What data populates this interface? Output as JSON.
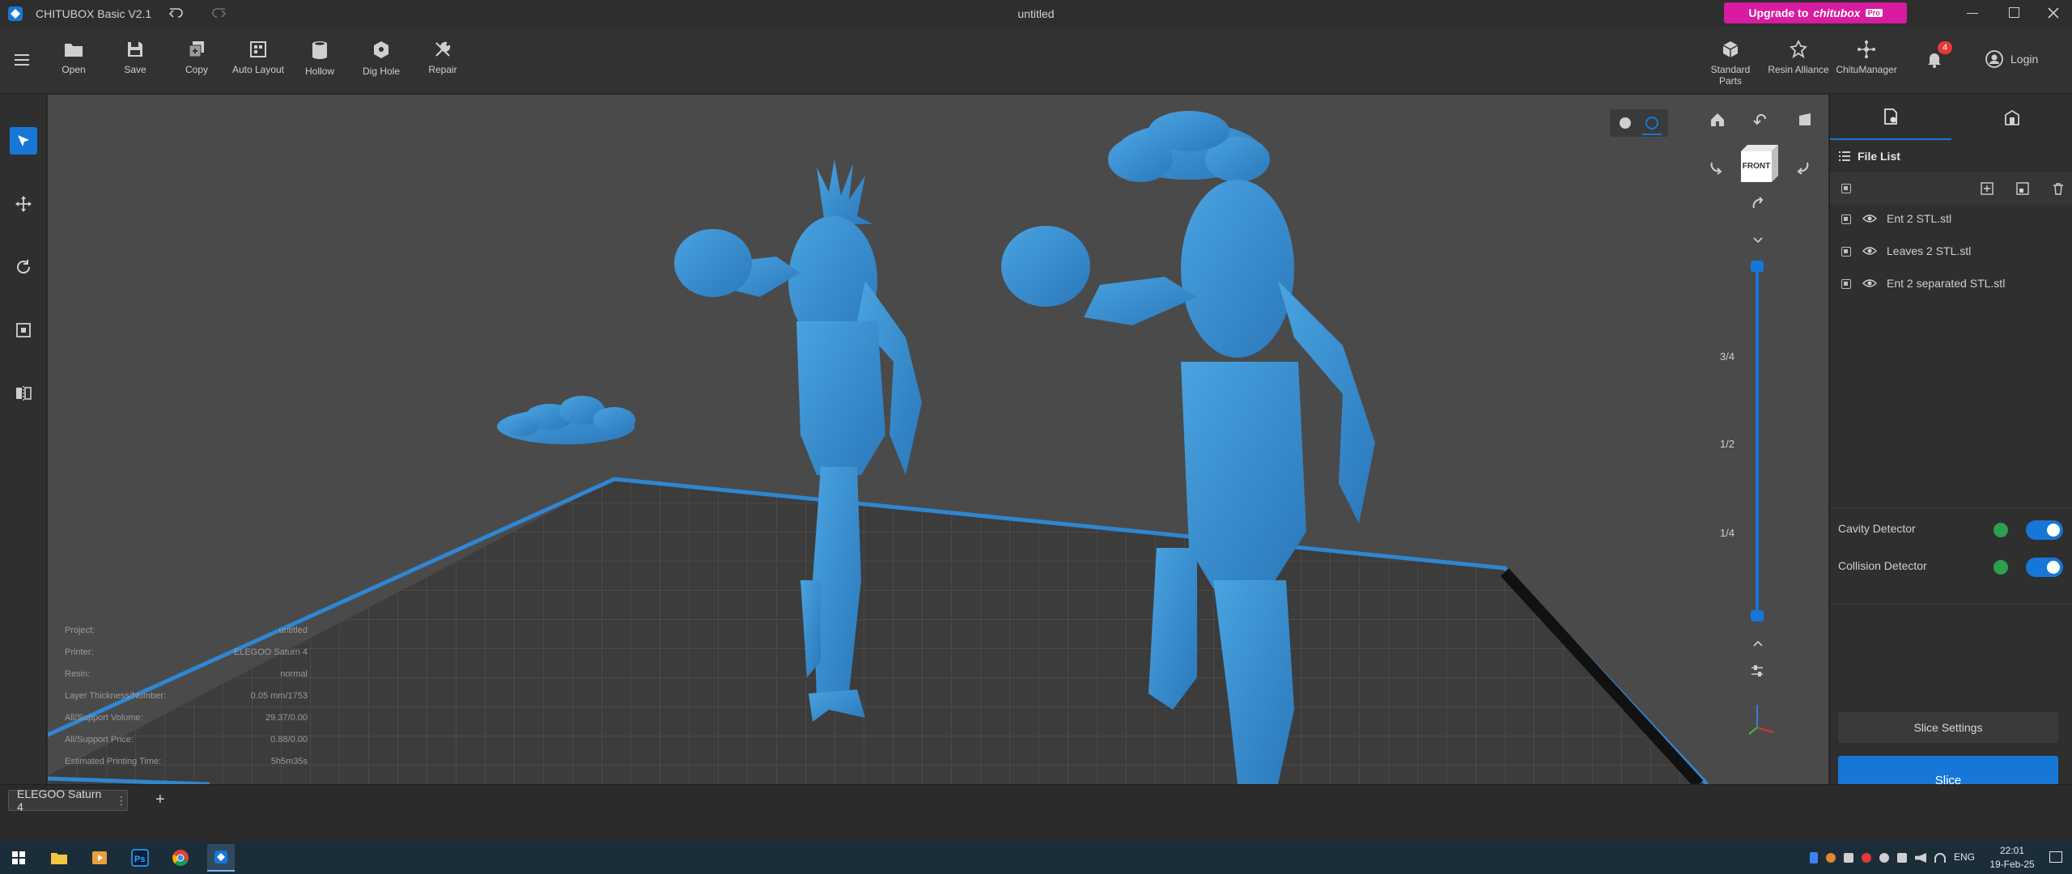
{
  "window": {
    "app_title": "CHITUBOX Basic V2.1",
    "doc_title": "untitled",
    "upgrade_prefix": "Upgrade to",
    "upgrade_brand": "chitubox",
    "upgrade_badge": "Pro"
  },
  "toolbar": {
    "items": [
      {
        "label": "Open",
        "icon": "folder-icon"
      },
      {
        "label": "Save",
        "icon": "save-icon"
      },
      {
        "label": "Copy",
        "icon": "copy-icon"
      },
      {
        "label": "Auto Layout",
        "icon": "auto-layout-icon"
      },
      {
        "label": "Hollow",
        "icon": "hollow-icon"
      },
      {
        "label": "Dig Hole",
        "icon": "dig-hole-icon"
      },
      {
        "label": "Repair",
        "icon": "repair-icon"
      }
    ],
    "right_items": [
      {
        "label": "Standard Parts"
      },
      {
        "label": "Resin Alliance"
      },
      {
        "label": "ChituManager"
      }
    ],
    "notification_count": "4",
    "login_label": "Login"
  },
  "viewport": {
    "view_cube_label": "FRONT",
    "slider_marks": [
      "3/4",
      "1/2",
      "1/4"
    ]
  },
  "project_info": {
    "rows": [
      {
        "label": "Project:",
        "value": "untitled"
      },
      {
        "label": "Printer:",
        "value": "ELEGOO Saturn 4"
      },
      {
        "label": "Resin:",
        "value": "normal"
      },
      {
        "label": "Layer Thickness/Number:",
        "value": "0.05 mm/1753"
      },
      {
        "label": "All/Support Volume:",
        "value": "29.37/0.00"
      },
      {
        "label": "All/Support Price:",
        "value": "0.88/0.00"
      },
      {
        "label": "Estimated Printing Time:",
        "value": "5h5m35s"
      }
    ]
  },
  "right_panel": {
    "file_list_title": "File List",
    "files": [
      "Ent 2 STL.stl",
      "Leaves 2 STL.stl",
      "Ent 2 separated STL.stl"
    ],
    "cavity_detector": "Cavity Detector",
    "collision_detector": "Collision Detector",
    "slice_settings": "Slice Settings",
    "slice": "Slice"
  },
  "bottom": {
    "printer_tab": "ELEGOO Saturn 4",
    "add_tab": "+"
  },
  "taskbar": {
    "language": "ENG",
    "time": "22:01",
    "date": "19-Feb-25"
  },
  "colors": {
    "accent": "#1677d6",
    "model": "#3a8fd0",
    "upgrade": "#d81ba0"
  }
}
